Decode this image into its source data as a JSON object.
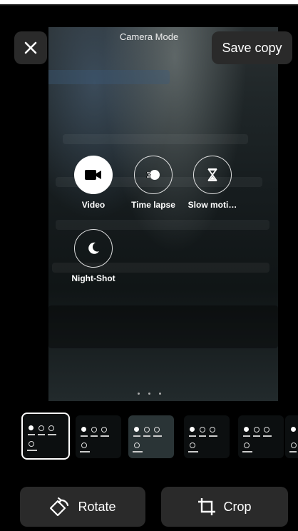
{
  "header": {
    "title": "Camera Mode",
    "save_label": "Save copy"
  },
  "modes": [
    {
      "label": "Video",
      "icon": "video-camera-icon",
      "active": true
    },
    {
      "label": "Time lapse",
      "icon": "time-lapse-icon",
      "active": false
    },
    {
      "label": "Slow moti…",
      "icon": "hourglass-icon",
      "active": false
    },
    {
      "label": "Night-Shot",
      "icon": "moon-icon",
      "active": false
    }
  ],
  "page_indicator": {
    "count": 3
  },
  "thumbnails": {
    "count": 6,
    "selected_index": 0
  },
  "actions": {
    "rotate_label": "Rotate",
    "crop_label": "Crop"
  }
}
